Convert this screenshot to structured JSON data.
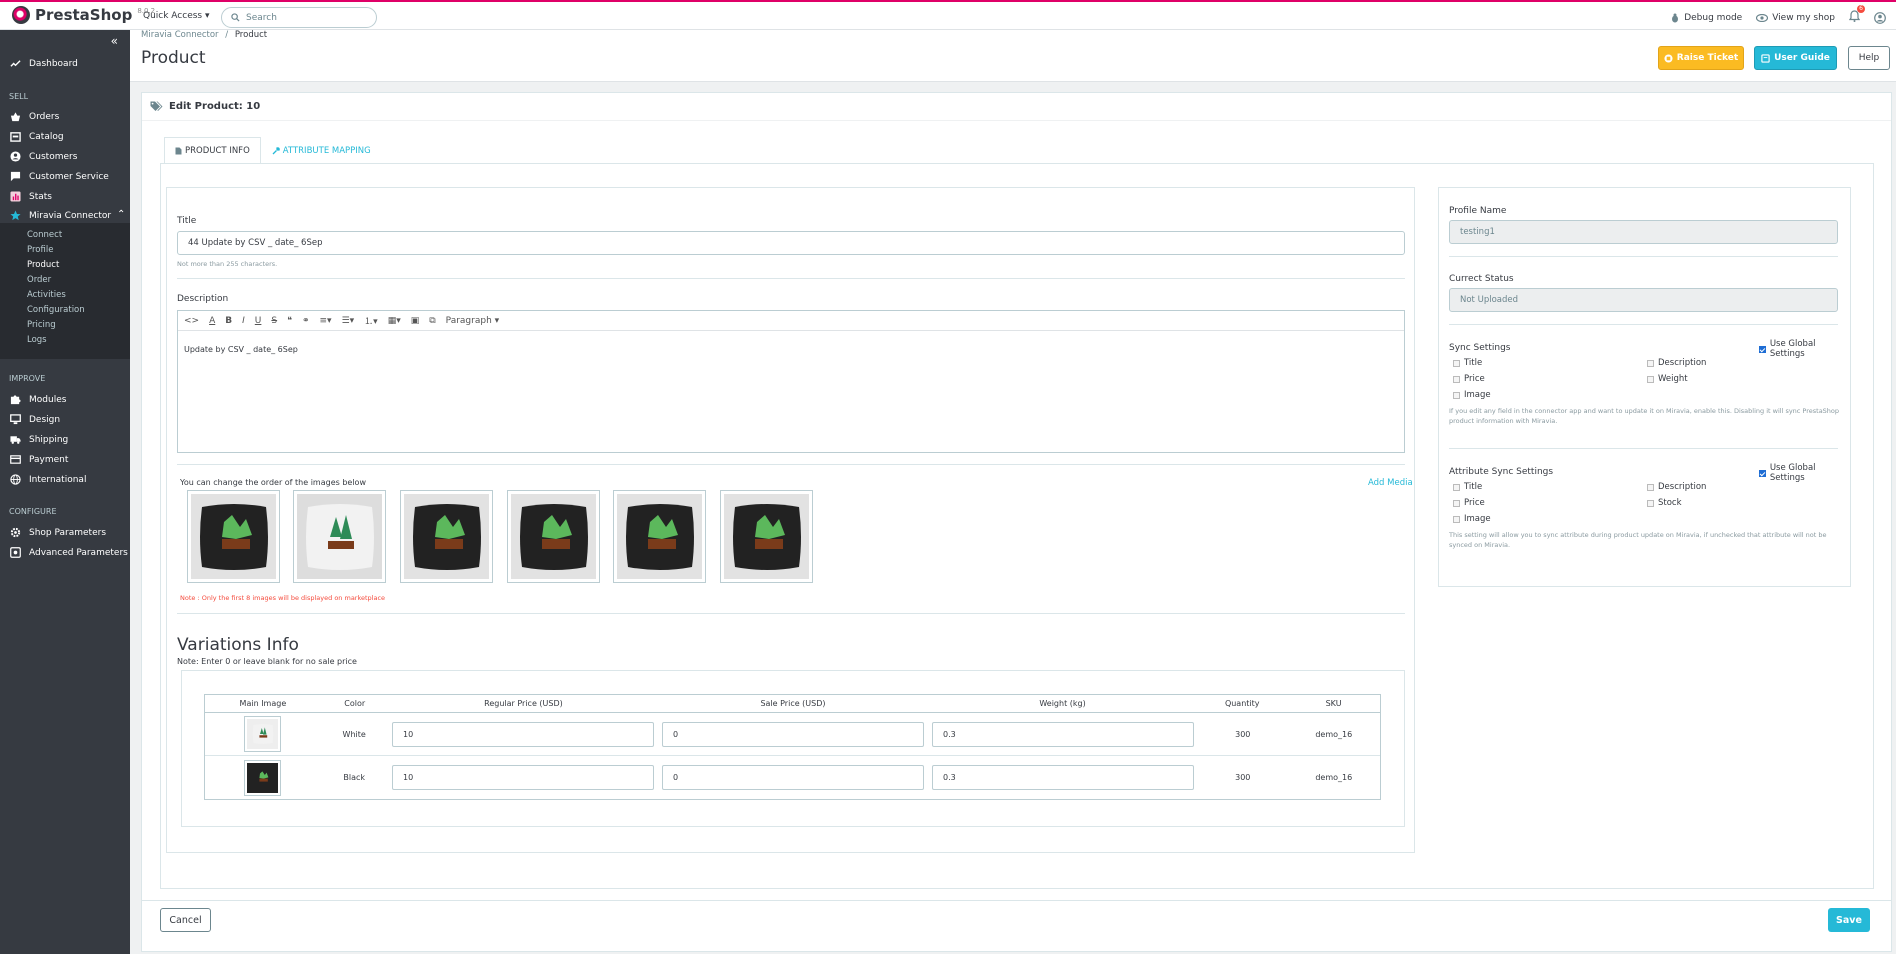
{
  "app": {
    "brand": "PrestaShop",
    "version": "8.0.2"
  },
  "topbar": {
    "quick_access": "Quick Access ▾",
    "search_placeholder": "Search",
    "debug_mode": "Debug mode",
    "view_shop": "View my shop",
    "notifications": "6"
  },
  "sidebar": {
    "dashboard": "Dashboard",
    "sell": "SELL",
    "orders": "Orders",
    "catalog": "Catalog",
    "customers": "Customers",
    "customer_service": "Customer Service",
    "stats": "Stats",
    "miravia": "Miravia Connector",
    "sub": [
      "Connect",
      "Profile",
      "Product",
      "Order",
      "Activities",
      "Configuration",
      "Pricing",
      "Logs"
    ],
    "improve": "IMPROVE",
    "modules": "Modules",
    "design": "Design",
    "shipping": "Shipping",
    "payment": "Payment",
    "international": "International",
    "configure": "CONFIGURE",
    "shop_params": "Shop Parameters",
    "adv_params": "Advanced Parameters"
  },
  "header": {
    "breadcrumb_parent": "Miravia Connector",
    "breadcrumb_sep": "/",
    "breadcrumb_current": "Product",
    "title": "Product",
    "raise_ticket": "Raise Ticket",
    "user_guide": "User Guide",
    "help": "Help"
  },
  "panel": {
    "title": "Edit Product: 10",
    "tabs": [
      "PRODUCT INFO",
      "ATTRIBUTE MAPPING"
    ]
  },
  "form": {
    "title_label": "Title",
    "title_value": "44 Update by CSV _ date_ 6Sep",
    "title_hint": "Not more than 255 characters.",
    "desc_label": "Description",
    "desc_paragraph": "Paragraph",
    "desc_value": "Update by CSV _ date_ 6Sep",
    "images_label": "You can change the order of the images below",
    "add_media": "Add Media",
    "images_note": "Note : Only the first 8 images will be displayed on marketplace"
  },
  "variations": {
    "title": "Variations Info",
    "note": "Note: Enter 0 or leave blank for no sale price",
    "headers": [
      "Main Image",
      "Color",
      "Regular Price (USD)",
      "Sale Price (USD)",
      "Weight (kg)",
      "Quantity",
      "SKU"
    ],
    "rows": [
      {
        "color": "White",
        "regular": "10",
        "sale": "0",
        "weight": "0.3",
        "qty": "300",
        "sku": "demo_16"
      },
      {
        "color": "Black",
        "regular": "10",
        "sale": "0",
        "weight": "0.3",
        "qty": "300",
        "sku": "demo_16"
      }
    ]
  },
  "right": {
    "profile_label": "Profile Name",
    "profile_value": "testing1",
    "status_label": "Currect Status",
    "status_value": "Not Uploaded",
    "sync_label": "Sync Settings",
    "use_global": "Use Global Settings",
    "sync_opts": [
      "Title",
      "Description",
      "Price",
      "Weight",
      "Image"
    ],
    "sync_note": "If you edit any field in the connector app and want to update it on Miravia, enable this. Disabling it will sync PrestaShop product information with Miravia.",
    "attr_label": "Attribute Sync Settings",
    "attr_opts": [
      "Title",
      "Description",
      "Price",
      "Stock",
      "Image"
    ],
    "attr_note": "This setting will allow you to sync attribute during product update on Miravia, if unchecked that attribute will not be synced on Miravia."
  },
  "footer": {
    "cancel": "Cancel",
    "save": "Save"
  },
  "colors": {
    "accent": "#25b9d7",
    "warning": "#fbbb22",
    "brand": "#df0067",
    "sidebar": "#363a41"
  }
}
